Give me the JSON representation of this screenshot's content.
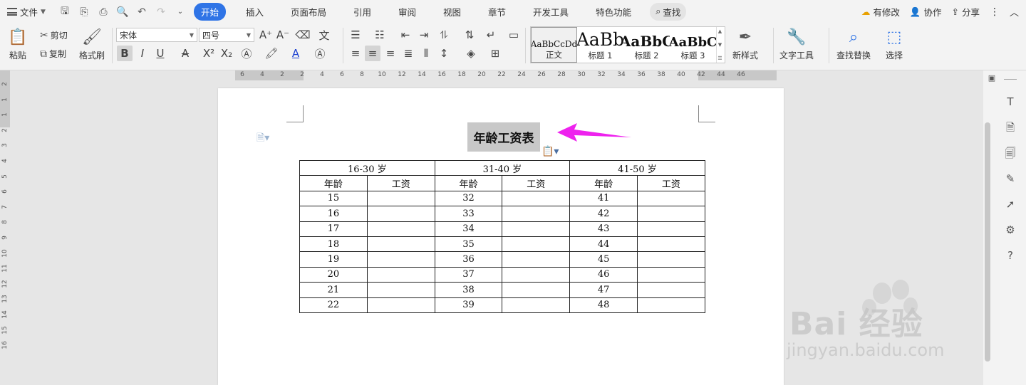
{
  "menubar": {
    "file_label": "文件",
    "tabs": [
      {
        "label": "开始",
        "active": true
      },
      {
        "label": "插入"
      },
      {
        "label": "页面布局"
      },
      {
        "label": "引用"
      },
      {
        "label": "审阅"
      },
      {
        "label": "视图"
      },
      {
        "label": "章节"
      },
      {
        "label": "开发工具"
      },
      {
        "label": "特色功能"
      }
    ],
    "search_label": "查找",
    "changes_label": "有修改",
    "collab_label": "协作",
    "share_label": "分享"
  },
  "ribbon": {
    "paste": "粘贴",
    "cut": "剪切",
    "copy": "复制",
    "format_painter": "格式刷",
    "font_family": "宋体",
    "font_size": "四号",
    "styles": [
      {
        "sample": "AaBbCcDd",
        "label": "正文",
        "selected": true
      },
      {
        "sample": "AaBb",
        "label": "标题 1"
      },
      {
        "sample": "AaBbC",
        "label": "标题 2"
      },
      {
        "sample": "AaBbC",
        "label": "标题 3"
      }
    ],
    "new_style": "新样式",
    "text_tools": "文字工具",
    "find_replace": "查找替换",
    "select": "选择"
  },
  "ruler": {
    "h_ticks": [
      "6",
      "4",
      "2",
      "2",
      "4",
      "6",
      "8",
      "10",
      "12",
      "14",
      "16",
      "18",
      "20",
      "22",
      "24",
      "26",
      "28",
      "30",
      "32",
      "34",
      "36",
      "38",
      "40",
      "42",
      "44",
      "46"
    ],
    "v_ticks": [
      "2",
      "1",
      "1",
      "2",
      "3",
      "4",
      "5",
      "6",
      "7",
      "8",
      "9",
      "10",
      "11",
      "12",
      "13",
      "14",
      "15",
      "16"
    ]
  },
  "document": {
    "title": "年龄工资表",
    "groups": [
      "16-30 岁",
      "31-40 岁",
      "41-50 岁"
    ],
    "subheaders": [
      "年龄",
      "工资",
      "年龄",
      "工资",
      "年龄",
      "工资"
    ],
    "rows": [
      [
        "15",
        "",
        "32",
        "",
        "41",
        ""
      ],
      [
        "16",
        "",
        "33",
        "",
        "42",
        ""
      ],
      [
        "17",
        "",
        "34",
        "",
        "43",
        ""
      ],
      [
        "18",
        "",
        "35",
        "",
        "44",
        ""
      ],
      [
        "19",
        "",
        "36",
        "",
        "45",
        ""
      ],
      [
        "20",
        "",
        "37",
        "",
        "46",
        ""
      ],
      [
        "21",
        "",
        "38",
        "",
        "47",
        ""
      ],
      [
        "22",
        "",
        "39",
        "",
        "48",
        ""
      ]
    ]
  },
  "watermark": {
    "brand": "Bai 经验",
    "url": "jingyan.baidu.com"
  },
  "colors": {
    "accent": "#2f74e6",
    "arrow": "#ee22ee",
    "title_highlight": "#c8c8c8"
  }
}
